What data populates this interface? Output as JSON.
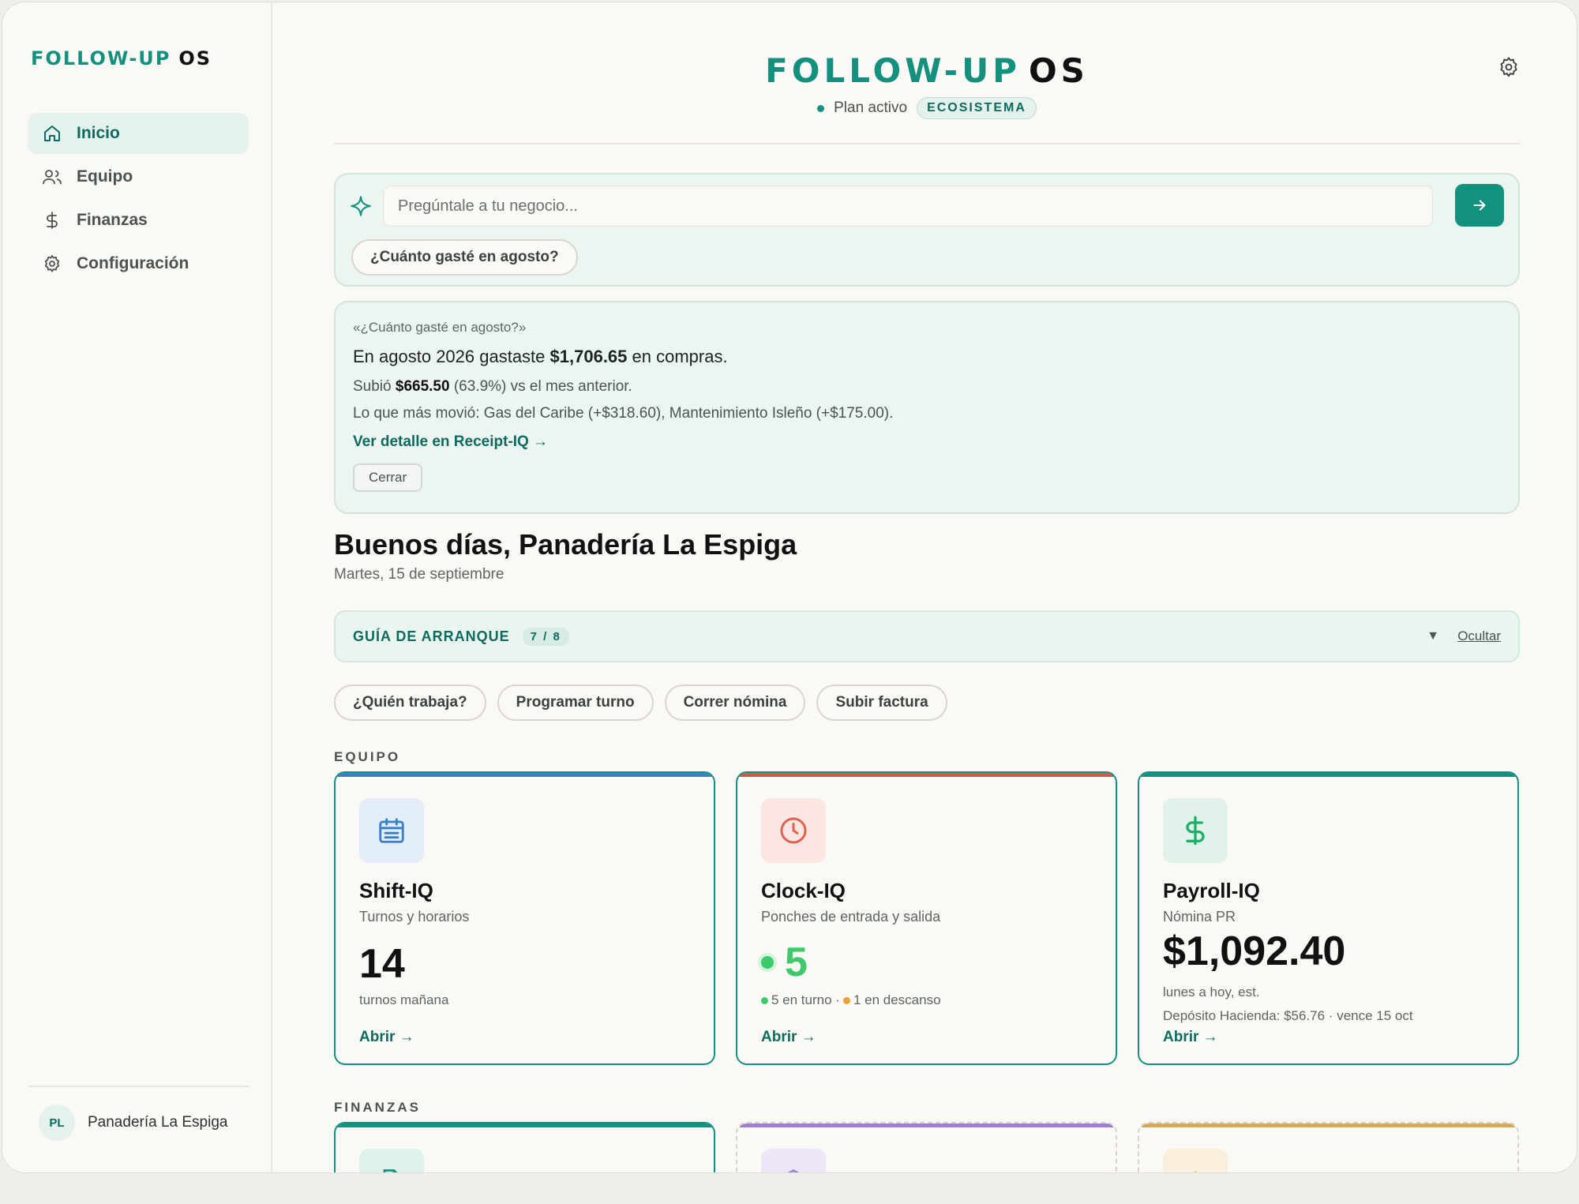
{
  "brand": {
    "word1": "FOLLOW-UP",
    "word2": "OS"
  },
  "sidebar": {
    "items": [
      {
        "label": "Inicio",
        "icon": "home-icon",
        "active": true
      },
      {
        "label": "Equipo",
        "icon": "users-icon",
        "active": false
      },
      {
        "label": "Finanzas",
        "icon": "dollar-icon",
        "active": false
      },
      {
        "label": "Configuración",
        "icon": "gear-icon",
        "active": false
      }
    ],
    "footer": {
      "initials": "PL",
      "business": "Panadería La Espiga"
    }
  },
  "header": {
    "plan_label": "Plan activo",
    "plan_badge": "ECOSISTEMA",
    "settings_icon": "gear-icon"
  },
  "ask": {
    "placeholder": "Pregúntale a tu negocio...",
    "suggestion": "¿Cuánto gasté en agosto?",
    "submit_icon": "arrow-right-icon"
  },
  "answer": {
    "question": "«¿Cuánto gasté en agosto?»",
    "line1_pre": "En agosto 2026 gastaste ",
    "line1_amount": "$1,706.65",
    "line1_post": " en compras.",
    "line2_pre": "Subió ",
    "line2_amount": "$665.50",
    "line2_post": " (63.9%) vs el mes anterior.",
    "line3": "Lo que más movió: Gas del Caribe (+$318.60), Mantenimiento Isleño (+$175.00).",
    "link": "Ver detalle en Receipt-IQ →",
    "close": "Cerrar"
  },
  "greeting": {
    "title": "Buenos días, Panadería La Espiga",
    "date": "Martes, 15 de septiembre"
  },
  "guide": {
    "title": "GUÍA DE ARRANQUE",
    "count": "7 / 8",
    "hide": "Ocultar"
  },
  "quick_actions": [
    "¿Quién trabaja?",
    "Programar turno",
    "Correr nómina",
    "Subir factura"
  ],
  "sections": {
    "equipo": "EQUIPO",
    "finanzas": "FINANZAS"
  },
  "cards": {
    "shift": {
      "name": "Shift-IQ",
      "sub": "Turnos y horarios",
      "value": "14",
      "caption": "turnos mañana",
      "open": "Abrir →",
      "icon": "calendar-icon",
      "accent": "#3b7fc4"
    },
    "clock": {
      "name": "Clock-IQ",
      "sub": "Ponches de entrada y salida",
      "value": "5",
      "legend_on": "5 en turno ·",
      "legend_break": "1 en descanso",
      "open": "Abrir →",
      "icon": "clock-icon",
      "accent": "#d9534a"
    },
    "payroll": {
      "name": "Payroll-IQ",
      "sub": "Nómina PR",
      "value": "$1,092.40",
      "caption1": "lunes a hoy, est.",
      "caption2": "Depósito Hacienda: $56.76 · vence 15 oct",
      "open": "Abrir →",
      "icon": "dollar-icon",
      "accent": "#14907f"
    }
  },
  "finance_cards": [
    {
      "icon": "document-icon",
      "accent": "#14907f"
    },
    {
      "icon": "box-icon",
      "accent": "#9b7fd6"
    },
    {
      "icon": "plus-icon",
      "accent": "#d4a955"
    }
  ],
  "colors": {
    "brand": "#14907f",
    "brand_dark": "#0c6b5e",
    "online": "#3ec96b",
    "break": "#f0a030"
  }
}
